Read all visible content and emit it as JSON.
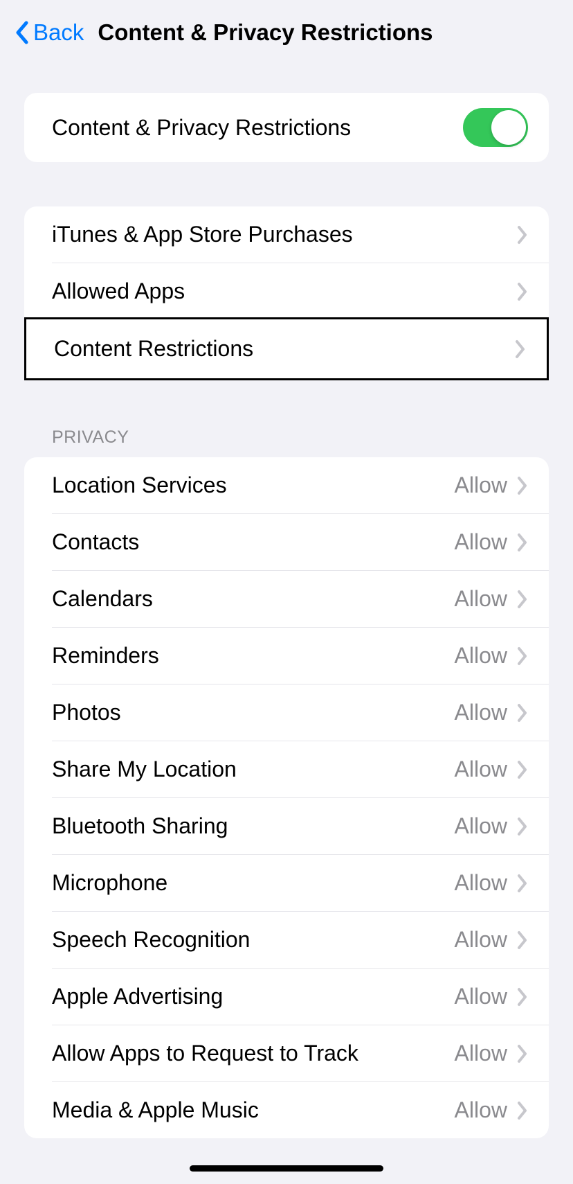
{
  "nav": {
    "back_label": "Back",
    "title": "Content & Privacy Restrictions"
  },
  "main_toggle": {
    "label": "Content & Privacy Restrictions",
    "enabled": true
  },
  "section1": {
    "items": [
      {
        "label": "iTunes & App Store Purchases"
      },
      {
        "label": "Allowed Apps"
      },
      {
        "label": "Content Restrictions"
      }
    ]
  },
  "privacy": {
    "header": "Privacy",
    "items": [
      {
        "label": "Location Services",
        "value": "Allow"
      },
      {
        "label": "Contacts",
        "value": "Allow"
      },
      {
        "label": "Calendars",
        "value": "Allow"
      },
      {
        "label": "Reminders",
        "value": "Allow"
      },
      {
        "label": "Photos",
        "value": "Allow"
      },
      {
        "label": "Share My Location",
        "value": "Allow"
      },
      {
        "label": "Bluetooth Sharing",
        "value": "Allow"
      },
      {
        "label": "Microphone",
        "value": "Allow"
      },
      {
        "label": "Speech Recognition",
        "value": "Allow"
      },
      {
        "label": "Apple Advertising",
        "value": "Allow"
      },
      {
        "label": "Allow Apps to Request to Track",
        "value": "Allow"
      },
      {
        "label": "Media & Apple Music",
        "value": "Allow"
      }
    ]
  }
}
